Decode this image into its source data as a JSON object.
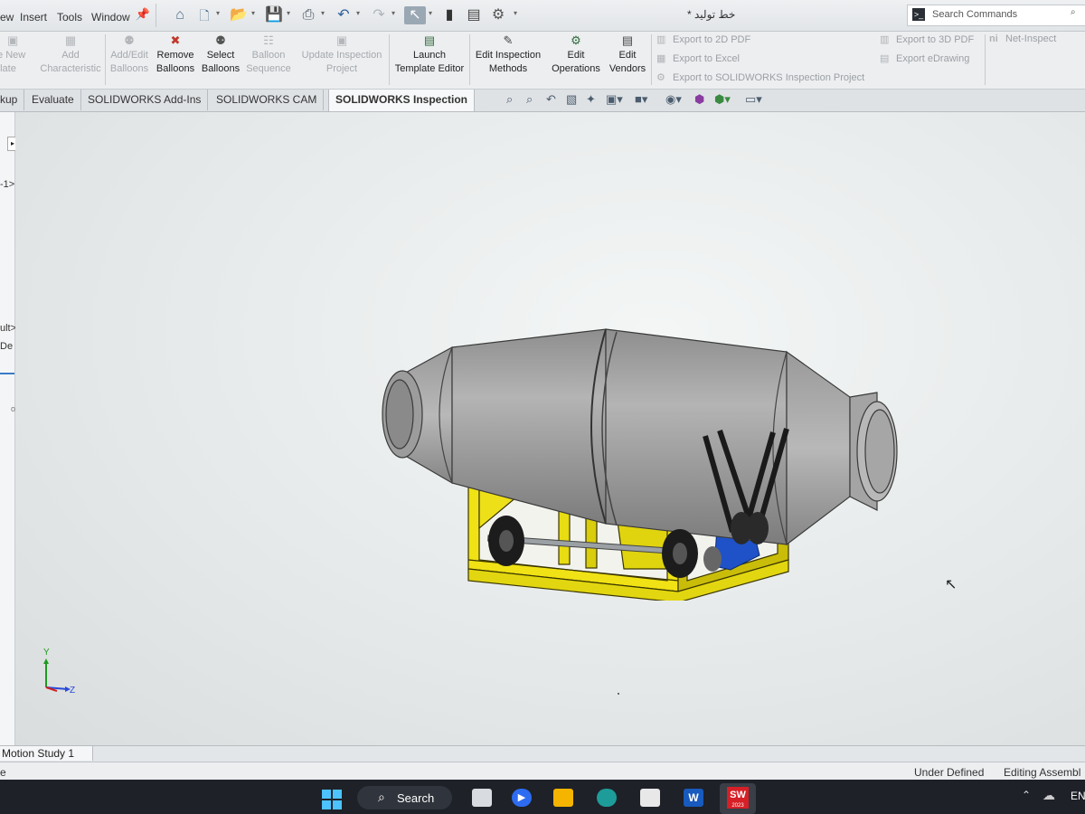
{
  "menu": {
    "items": [
      "ew",
      "Insert",
      "Tools",
      "Window"
    ],
    "pin_icon": "pin-icon"
  },
  "quick_access": {
    "icons": [
      "home-icon",
      "new-document-icon",
      "open-folder-icon",
      "save-icon",
      "print-icon",
      "undo-icon",
      "redo-icon",
      "select-arrow-icon",
      "rebuild-icon",
      "file-properties-icon",
      "options-gear-icon"
    ]
  },
  "document_title": "خط تولید *",
  "search": {
    "placeholder": "Search Commands"
  },
  "ribbon": {
    "create_new_template": [
      "te New",
      "plate"
    ],
    "add_characteristic": [
      "Add",
      "Characteristic"
    ],
    "add_edit_balloons": [
      "Add/Edit",
      "Balloons"
    ],
    "remove_balloons": [
      "Remove",
      "Balloons"
    ],
    "select_balloons": [
      "Select",
      "Balloons"
    ],
    "balloon_sequence": [
      "Balloon",
      "Sequence"
    ],
    "update_inspection_project": [
      "Update Inspection",
      "Project"
    ],
    "launch_template_editor": [
      "Launch",
      "Template Editor"
    ],
    "edit_inspection_methods": [
      "Edit Inspection",
      "Methods"
    ],
    "edit_operations": [
      "Edit",
      "Operations"
    ],
    "edit_vendors": [
      "Edit",
      "Vendors"
    ],
    "export_2d_pdf": "Export to 2D PDF",
    "export_excel": "Export to Excel",
    "export_sw_inspection": "Export to SOLIDWORKS Inspection Project",
    "export_3d_pdf": "Export to 3D PDF",
    "export_edrawing": "Export eDrawing",
    "net_inspect": "Net-Inspect"
  },
  "tabs": [
    "kup",
    "Evaluate",
    "SOLIDWORKS Add-Ins",
    "SOLIDWORKS CAM",
    "SOLIDWORKS Inspection"
  ],
  "active_tab": "SOLIDWORKS Inspection",
  "left_panel": {
    "item_1": "-1>",
    "item_2": "ult>",
    "item_3": "De",
    "item_4": "o"
  },
  "triad": {
    "y": "Y",
    "z": "Z"
  },
  "motion_study": "Motion Study 1",
  "status": {
    "left": "e",
    "state": "Under Defined",
    "mode": "Editing Assembl"
  },
  "taskbar": {
    "search_label": "Search",
    "apps": [
      "start-icon",
      "file-explorer-icon",
      "zoom-icon",
      "folder-icon",
      "edge-icon",
      "store-icon",
      "word-icon",
      "solidworks-icon"
    ],
    "solidworks_badge": "SW",
    "solidworks_year": "2023",
    "language": "EN"
  },
  "colors": {
    "frame_yellow": "#e8dc12",
    "drum_gray": "#a2a2a2",
    "motor_blue": "#1f52c8",
    "taskbar": "#1e2128"
  }
}
